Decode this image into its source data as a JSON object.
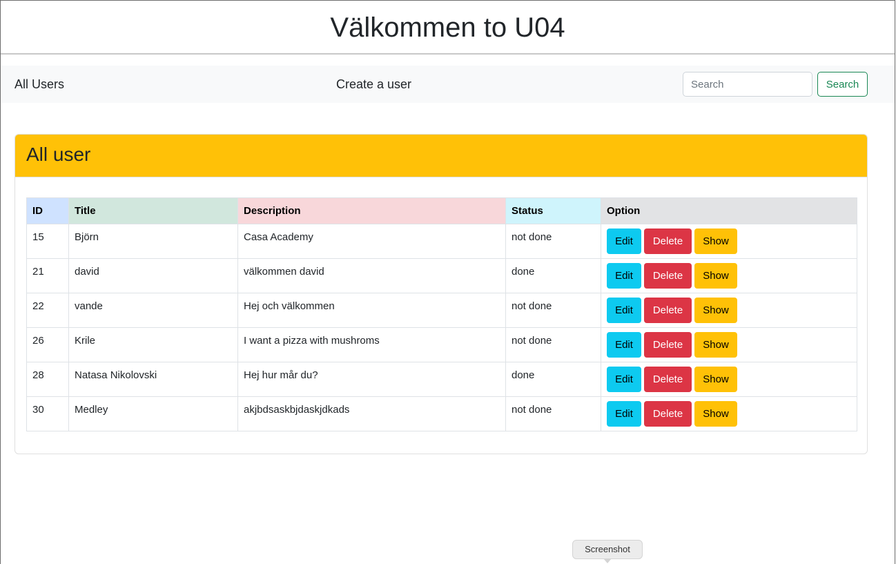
{
  "header": {
    "title": "Välkommen to U04"
  },
  "nav": {
    "all_users": "All Users",
    "create_user": "Create a user",
    "search_placeholder": "Search",
    "search_button": "Search"
  },
  "card": {
    "title": "All user"
  },
  "table": {
    "headers": [
      "ID",
      "Title",
      "Description",
      "Status",
      "Option"
    ],
    "header_colors": [
      "#cfe2ff",
      "#d1e7dd",
      "#f8d7da",
      "#cff4fc",
      "#e2e3e5"
    ],
    "rows": [
      {
        "id": "15",
        "title": "Björn",
        "description": "Casa Academy",
        "status": "not done"
      },
      {
        "id": "21",
        "title": "david",
        "description": "välkommen david",
        "status": "done"
      },
      {
        "id": "22",
        "title": "vande",
        "description": "Hej och välkommen",
        "status": "not done"
      },
      {
        "id": "26",
        "title": "Krile",
        "description": "I want a pizza with mushroms",
        "status": "not done"
      },
      {
        "id": "28",
        "title": "Natasa Nikolovski",
        "description": "Hej hur mår du?",
        "status": "done"
      },
      {
        "id": "30",
        "title": "Medley",
        "description": "akjbdsaskbjdaskjdkads",
        "status": "not done"
      }
    ],
    "actions": {
      "edit": "Edit",
      "delete": "Delete",
      "show": "Show"
    }
  },
  "colors": {
    "card_header": "#ffc107",
    "edit": "#0dcaf0",
    "delete": "#dc3545",
    "show": "#ffc107",
    "search_outline": "#198754"
  },
  "tooltip": {
    "text": "Screenshot"
  }
}
